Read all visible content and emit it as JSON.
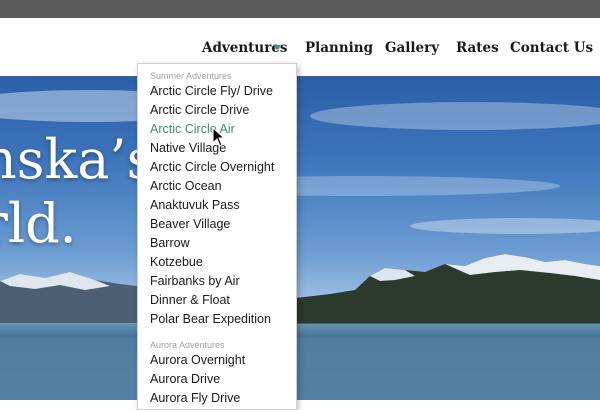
{
  "nav": {
    "adventures": "Adventures",
    "planning": "Planning",
    "gallery": "Gallery",
    "rates": "Rates",
    "contact": "Contact Us"
  },
  "hero": {
    "line1": "nska’s",
    "line2": "rld."
  },
  "menu": {
    "summer_heading": "Summer Adventures",
    "summer_items": [
      "Arctic Circle Fly/ Drive",
      "Arctic Circle Drive",
      "Arctic Circle Air",
      "Native Village",
      "Arctic Circle Overnight",
      "Arctic Ocean",
      "Anaktuvuk Pass",
      "Beaver Village",
      "Barrow",
      "Kotzebue",
      "Fairbanks by Air",
      "Dinner & Float",
      "Polar Bear Expedition"
    ],
    "aurora_heading": "Aurora Adventures",
    "aurora_items": [
      "Aurora Overnight",
      "Aurora Drive",
      "Aurora Fly Drive"
    ],
    "hovered_item": "Arctic Circle Air"
  },
  "colors": {
    "topbar": "#5c5c5c",
    "caret": "#3a8a8a",
    "hover_text": "#3f8a78"
  }
}
